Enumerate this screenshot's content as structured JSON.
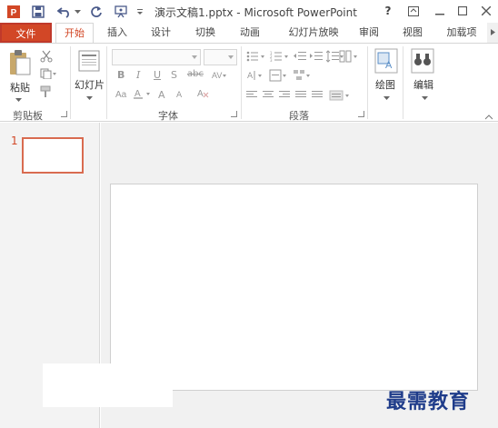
{
  "window": {
    "title": "演示文稿1.pptx - Microsoft PowerPoint",
    "help_label": "?",
    "app_logo_letter": "P"
  },
  "quick_access": [
    {
      "name": "save-icon"
    },
    {
      "name": "undo-icon"
    },
    {
      "name": "redo-icon"
    },
    {
      "name": "start-from-beginning-icon"
    },
    {
      "name": "customize-qat-icon"
    }
  ],
  "tabs": [
    {
      "label": "文件",
      "kind": "file"
    },
    {
      "label": "开始",
      "kind": "active"
    },
    {
      "label": "插入"
    },
    {
      "label": "设计"
    },
    {
      "label": "切换"
    },
    {
      "label": "动画"
    },
    {
      "label": "幻灯片放映"
    },
    {
      "label": "审阅"
    },
    {
      "label": "视图"
    },
    {
      "label": "加载项"
    }
  ],
  "ribbon": {
    "clipboard": {
      "paste_label": "粘贴",
      "group_label": "剪贴板"
    },
    "slides": {
      "new_slide_label": "幻灯片"
    },
    "font": {
      "group_label": "字体",
      "font_name": "",
      "font_size": "",
      "bold": "B",
      "italic": "I",
      "underline": "U",
      "shadow": "S",
      "strikethrough": "abc",
      "grow": "A",
      "shrink": "A"
    },
    "paragraph": {
      "group_label": "段落"
    },
    "drawing": {
      "label": "绘图"
    },
    "editing": {
      "label": "编辑"
    }
  },
  "slides_pane": {
    "slide_number": "1"
  },
  "watermark": "最需教育",
  "colors": {
    "accent": "#d24726",
    "file_tab": "#d24726",
    "watermark": "#1f3c8a"
  }
}
